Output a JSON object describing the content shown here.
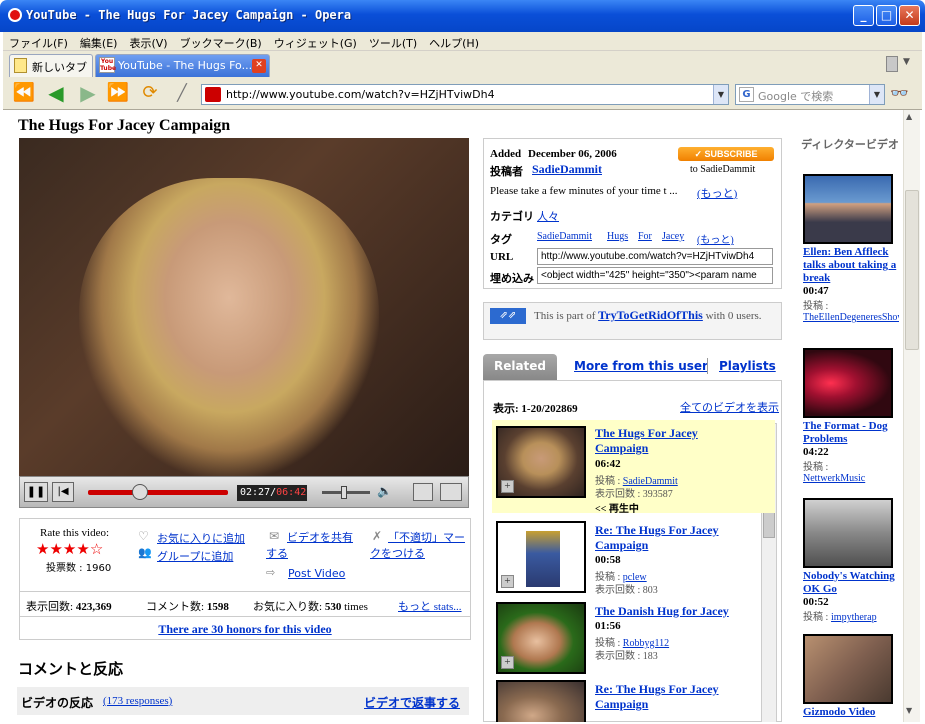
{
  "window": {
    "title": "YouTube - The Hugs For Jacey Campaign - Opera"
  },
  "menu": [
    "ファイル(F)",
    "編集(E)",
    "表示(V)",
    "ブックマーク(B)",
    "ウィジェット(G)",
    "ツール(T)",
    "ヘルプ(H)"
  ],
  "tabs": [
    {
      "label": "新しいタブ"
    },
    {
      "label": "YouTube - The Hugs Fo..."
    }
  ],
  "address": {
    "url": "http://www.youtube.com/watch?v=HZjHTviwDh4",
    "search_placeholder": "Google で検索"
  },
  "video": {
    "title": "The Hugs For Jacey Campaign",
    "time_current": "02:27",
    "time_total": "06:42",
    "progress": 0.37,
    "volume": 0.45
  },
  "rating": {
    "label": "Rate this video:",
    "stars_filled": 4,
    "stars_total": 5,
    "votes": "投票数 : 1960"
  },
  "actions": {
    "favorite": "お気に入りに追加",
    "group": "グループに追加",
    "share": "ビデオを共有する",
    "flag": "「不適切」マークをつける",
    "post": "Post Video"
  },
  "stats": {
    "views_label": "表示回数:",
    "views": "423,369",
    "comments_label": "コメント数:",
    "comments": "1598",
    "favs_label": "お気に入り数:",
    "favs": "530",
    "favs_suffix": "times",
    "more": "もっと stats..."
  },
  "honors": "There are 30 honors for this video",
  "comments": {
    "heading": "コメントと反応",
    "video_responses_label": "ビデオの反応",
    "responses": "(173 responses)",
    "reply": "ビデオで返事する"
  },
  "info": {
    "added_label": "Added",
    "added": "December 06, 2006",
    "by_label": "投稿者",
    "user": "SadieDammit",
    "subscribe": "SUBSCRIBE",
    "to": "to SadieDammit",
    "desc": "Please take a few minutes of your time t ...",
    "more": "(もっと)",
    "category_label": "カテゴリ",
    "category": "人々",
    "tags_label": "タグ",
    "tags": [
      "SadieDammit",
      "Hugs",
      "For",
      "Jacey"
    ],
    "tags_more": "(もっと)",
    "url_label": "URL",
    "url": "http://www.youtube.com/watch?v=HZjHTviwDh4",
    "embed_label": "埋め込み",
    "embed": "<object width=\"425\" height=\"350\"><param name"
  },
  "playlist": {
    "prefix": "This is part of",
    "name": "TryToGetRidOfThis",
    "suffix": "with 0 users."
  },
  "related_tabs": {
    "related": "Related",
    "more": "More from this user",
    "playlists": "Playlists"
  },
  "related": {
    "count": "表示: 1-20/202869",
    "all": "全てのビデオを表示",
    "items": [
      {
        "title": "The Hugs For Jacey Campaign",
        "duration": "06:42",
        "by_label": "投稿 :",
        "user": "SadieDammit",
        "views": "表示回数 : 393587",
        "now": "<< 再生中"
      },
      {
        "title": "Re: The Hugs For Jacey Campaign",
        "duration": "00:58",
        "by_label": "投稿 :",
        "user": "pclew",
        "views": "表示回数 : 803"
      },
      {
        "title": "The Danish Hug for Jacey",
        "duration": "01:56",
        "by_label": "投稿 :",
        "user": "Robbyg112",
        "views": "表示回数 : 183"
      },
      {
        "title": "Re: The Hugs For Jacey Campaign",
        "duration": "",
        "by_label": "",
        "user": "",
        "views": ""
      }
    ]
  },
  "director": {
    "heading": "ディレクタービデオ",
    "items": [
      {
        "title": "Ellen: Ben Affleck talks about taking a break",
        "duration": "00:47",
        "by_label": "投稿 :",
        "user": "TheEllenDegeneresShow"
      },
      {
        "title": "The Format - Dog Problems",
        "duration": "04:22",
        "by_label": "投稿 :",
        "user": "NettwerkMusic"
      },
      {
        "title": "Nobody's Watching OK Go",
        "duration": "00:52",
        "by_label": "投稿 :",
        "user": "impytherap"
      },
      {
        "title": "Gizmodo Video",
        "duration": "",
        "by_label": "",
        "user": ""
      }
    ]
  }
}
